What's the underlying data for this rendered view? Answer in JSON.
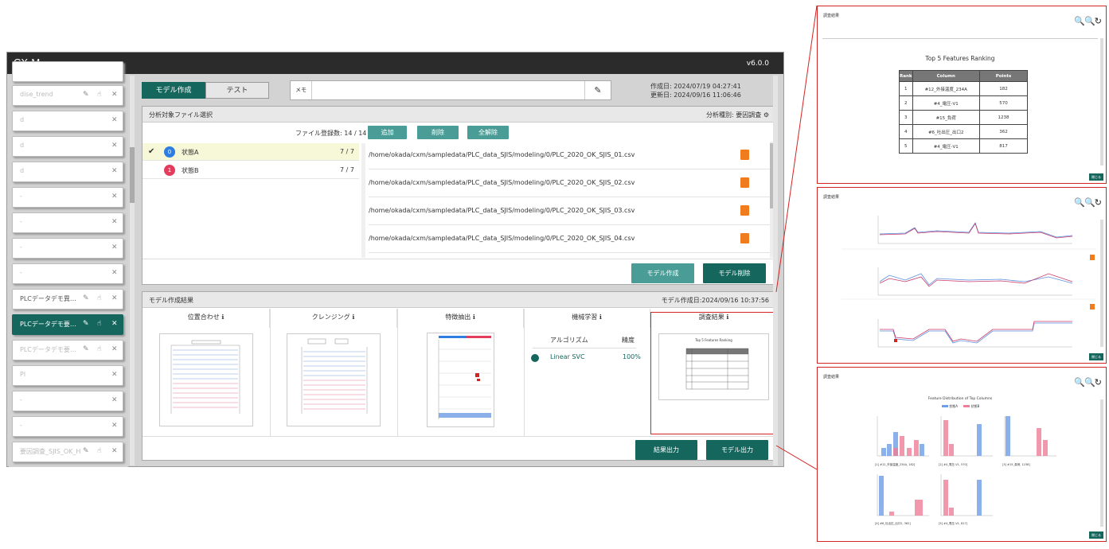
{
  "app": {
    "title": "CX-M",
    "version": "v6.0.0"
  },
  "sidebar": {
    "items": [
      {
        "label": "dise_trend"
      },
      {
        "label": "d"
      },
      {
        "label": "d"
      },
      {
        "label": "d"
      },
      {
        "label": "-"
      },
      {
        "label": "-"
      },
      {
        "label": "-"
      },
      {
        "label": "-"
      },
      {
        "label": "PLCデータデモ異…"
      },
      {
        "label": "PLCデータデモ要…"
      },
      {
        "label": "PLCデータデモ要…"
      },
      {
        "label": "Pl"
      },
      {
        "label": "-"
      },
      {
        "label": "-"
      },
      {
        "label": "要因調査_SJIS_OK_H"
      }
    ]
  },
  "tabs": {
    "model": "モデル作成",
    "test": "テスト"
  },
  "memo": {
    "label": "メモ",
    "value": ""
  },
  "dates": {
    "created": "作成日: 2024/07/19 04:27:41",
    "updated": "更新日: 2024/09/16 11:06:46"
  },
  "file_panel": {
    "title": "分析対象ファイル選択",
    "analysis_type": "分析種別: 要因調査",
    "count": "ファイル登録数: 14 / 14",
    "add": "追加",
    "delete": "削除",
    "clear_all": "全解除",
    "states": [
      {
        "badge": "0",
        "name": "状態A",
        "count": "7 / 7",
        "color": "#2f7de1"
      },
      {
        "badge": "1",
        "name": "状態B",
        "count": "7 / 7",
        "color": "#e33d5d"
      }
    ],
    "files": [
      "/home/okada/cxm/sampledata/PLC_data_SJIS/modeling/0/PLC_2020_OK_SJIS_01.csv",
      "/home/okada/cxm/sampledata/PLC_data_SJIS/modeling/0/PLC_2020_OK_SJIS_02.csv",
      "/home/okada/cxm/sampledata/PLC_data_SJIS/modeling/0/PLC_2020_OK_SJIS_03.csv",
      "/home/okada/cxm/sampledata/PLC_data_SJIS/modeling/0/PLC_2020_OK_SJIS_04.csv"
    ],
    "create_model": "モデル作成",
    "delete_model": "モデル削除"
  },
  "result_panel": {
    "title": "モデル作成結果",
    "created": "モデル作成日:2024/09/16 10:37:56",
    "columns": [
      "位置合わせ",
      "クレンジング",
      "特徴抽出",
      "機械学習",
      "調査結果"
    ],
    "ml": {
      "algo_header": "アルゴリズム",
      "acc_header": "精度",
      "algo": "Linear SVC",
      "acc": "100%"
    },
    "export_result": "結果出力",
    "export_model": "モデル出力"
  },
  "ranking": {
    "panel_label": "調査結果",
    "title": "Top 5 Features Ranking",
    "headers": [
      "Rank",
      "Column",
      "Points"
    ],
    "rows": [
      {
        "rank": "1",
        "column": "#12_外接温度_234A",
        "points": "182"
      },
      {
        "rank": "2",
        "column": "#4_電圧-V1",
        "points": "570"
      },
      {
        "rank": "3",
        "column": "#15_負荷",
        "points": "1238"
      },
      {
        "rank": "4",
        "column": "#6_吐出圧_出口2",
        "points": "362"
      },
      {
        "rank": "5",
        "column": "#4_電圧-V1",
        "points": "817"
      }
    ],
    "close": "閉じる"
  },
  "timeseries": {
    "panel_label": "調査結果",
    "close": "閉じる"
  },
  "distribution": {
    "panel_label": "調査結果",
    "title": "Feature Distribution of Top Columns",
    "legend": [
      "状態A",
      "状態B"
    ],
    "captions": [
      "[1] #12_外接温度_234A, 182]",
      "[2] #4_電圧-V1, 570]",
      "[3] #15_負荷, 1238]",
      "[4] #6_吐出圧_出口2, 362]",
      "[5] #4_電圧-V1, 817]"
    ],
    "close": "閉じる"
  },
  "colors": {
    "accent": "#15675e",
    "button": "#4a9d96",
    "stateA": "#6f9ee8",
    "stateB": "#ef7f98",
    "highlight": "#d32323"
  }
}
